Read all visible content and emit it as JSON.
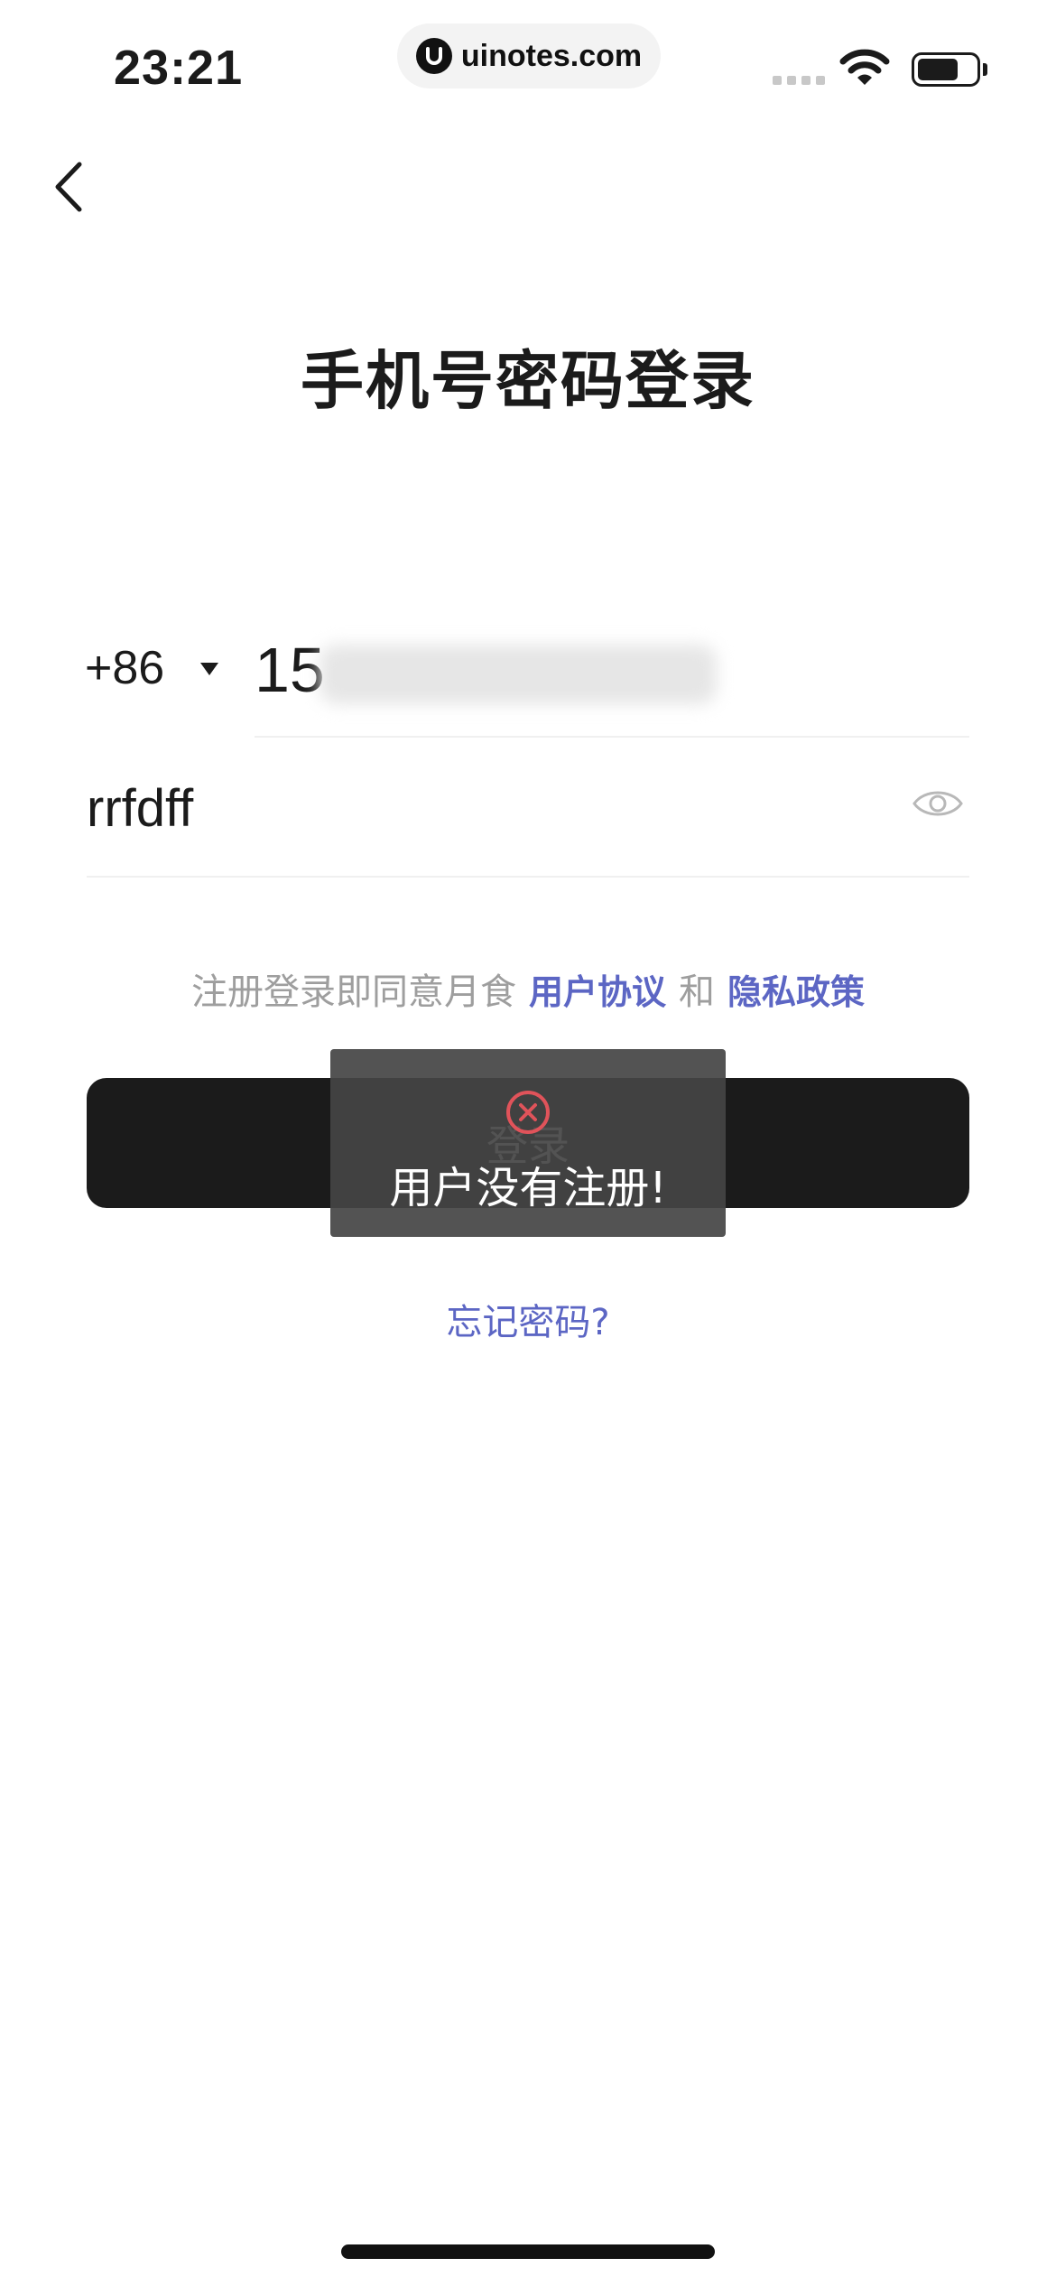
{
  "status_bar": {
    "time": "23:21",
    "url": "uinotes.com"
  },
  "page": {
    "title": "手机号密码登录"
  },
  "form": {
    "country_code": "+86",
    "phone_visible_prefix": "15",
    "password_value": "rrfdff"
  },
  "agreement": {
    "prefix": "注册登录即同意月食",
    "user_agreement": "用户协议",
    "and": "和",
    "privacy_policy": "隐私政策"
  },
  "login_button": {
    "label": "登录"
  },
  "toast": {
    "message": "用户没有注册!",
    "icon": "close-circle-icon",
    "icon_color": "#e0535a"
  },
  "forgot_password": {
    "label": "忘记密码?"
  },
  "colors": {
    "link": "#5c66c4",
    "button": "#1b1b1b",
    "hint_text": "#9e9e9e"
  }
}
